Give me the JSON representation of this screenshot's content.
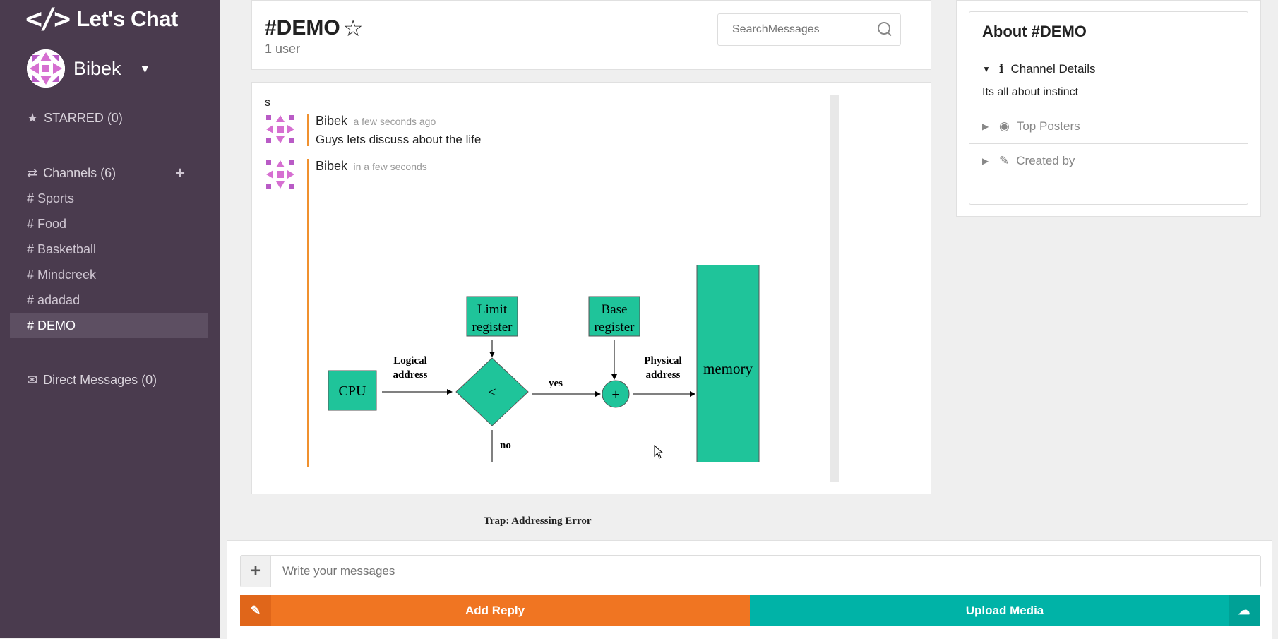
{
  "brand": {
    "logo": "</>",
    "name": "Let's Chat"
  },
  "user": {
    "name": "Bibek"
  },
  "sidebar": {
    "starred": "STARRED (0)",
    "channels_label": "Channels (6)",
    "channels": [
      {
        "label": "# Sports"
      },
      {
        "label": "# Food"
      },
      {
        "label": "# Basketball"
      },
      {
        "label": "# Mindcreek"
      },
      {
        "label": "# adadad"
      },
      {
        "label": "# DEMO",
        "active": true
      }
    ],
    "direct_messages": "Direct Messages (0)"
  },
  "header": {
    "title": "#DEMO",
    "users": "1 user",
    "search_placeholder": "SearchMessages"
  },
  "messages": {
    "stray": "s",
    "items": [
      {
        "author": "Bibek",
        "time": "a few seconds ago",
        "text": "Guys lets discuss about the life"
      },
      {
        "author": "Bibek",
        "time": "in a few seconds",
        "text": ""
      }
    ]
  },
  "diagram": {
    "cpu": "CPU",
    "logical_address": [
      "Logical",
      "address"
    ],
    "limit_register": [
      "Limit",
      "register"
    ],
    "compare": "<",
    "yes": "yes",
    "no": "no",
    "base_register": [
      "Base",
      "register"
    ],
    "plus": "+",
    "physical_address": [
      "Physical",
      "address"
    ],
    "memory": "memory",
    "trap": "Trap: Addressing Error"
  },
  "about": {
    "title": "About #DEMO",
    "channel_details": "Channel Details",
    "description": "Its all about instinct",
    "top_posters": "Top Posters",
    "created_by": "Created by"
  },
  "composer": {
    "placeholder": "Write your messages",
    "add_reply": "Add Reply",
    "upload_media": "Upload Media"
  },
  "colors": {
    "sidebar_bg": "#4a3b4e",
    "accent_orange": "#f07522",
    "accent_teal": "#00b3a7",
    "diagram_green": "#1fc49a"
  }
}
